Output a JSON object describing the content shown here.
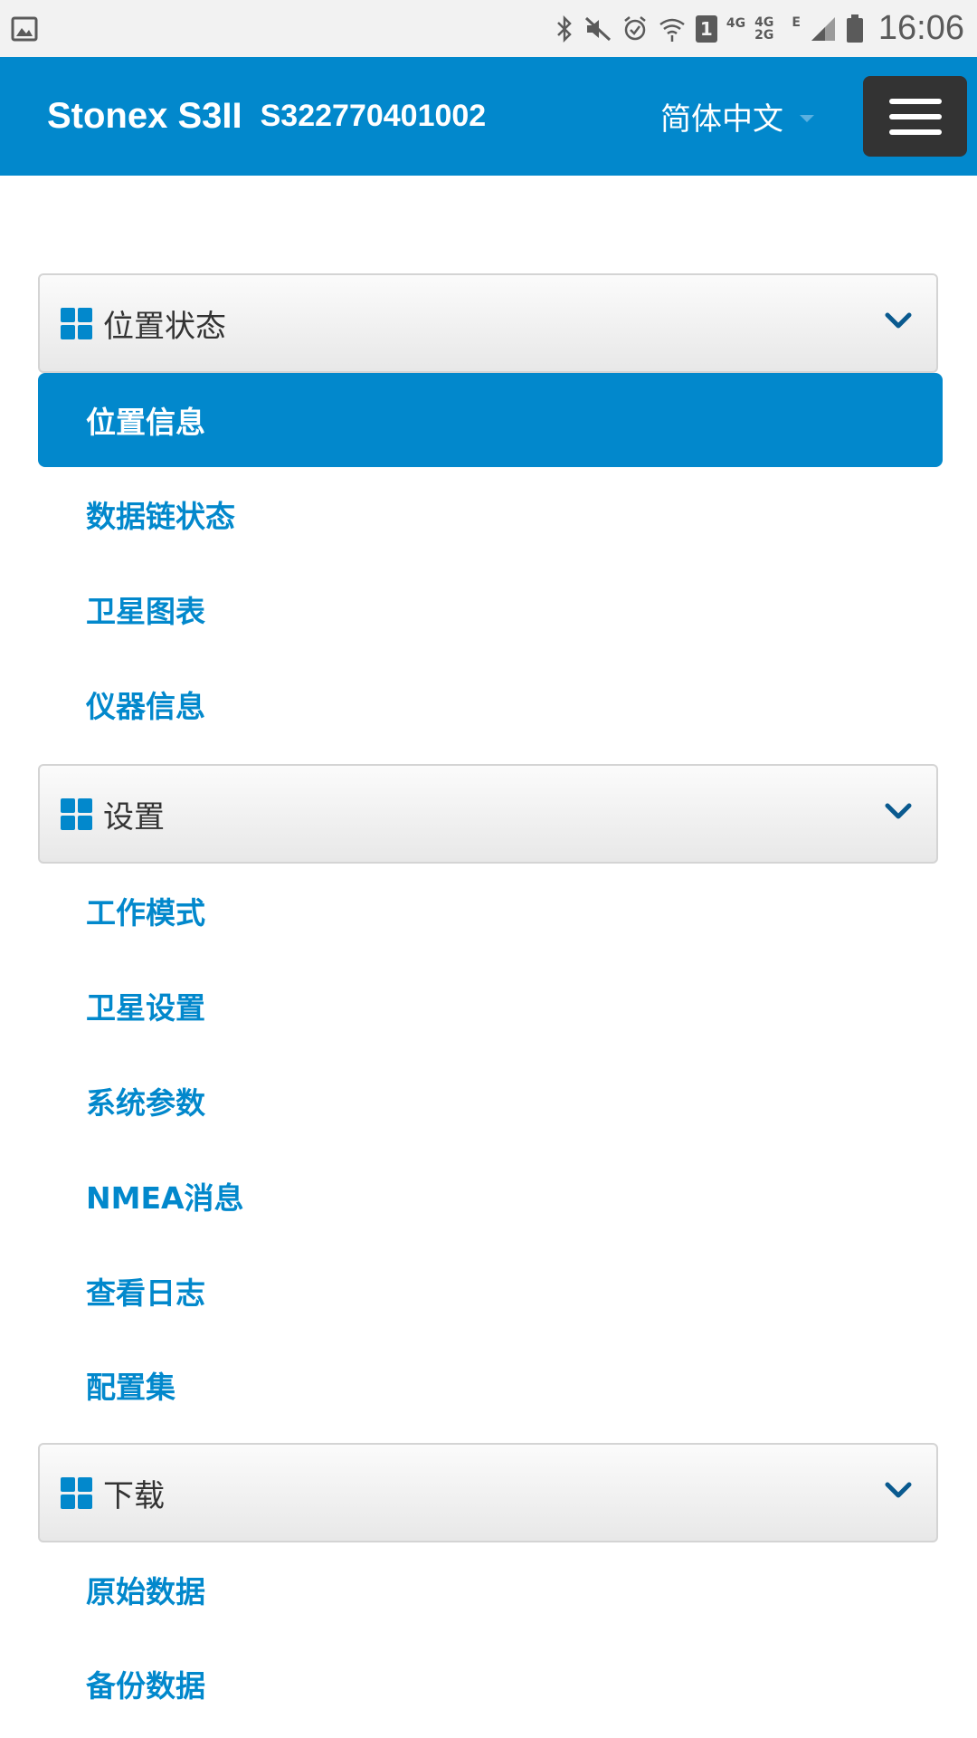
{
  "status_bar": {
    "time": "16:06",
    "sim_badge": "1",
    "net_4g": "4G",
    "net_4g_top": "4G",
    "net_2g_bottom": "2G",
    "net_e": "E",
    "icons": [
      "gallery-icon",
      "bluetooth-icon",
      "mute-icon",
      "alarm-icon",
      "wifi-icon",
      "sim-icon",
      "signal-icon",
      "battery-icon"
    ]
  },
  "header": {
    "brand": "Stonex S3II",
    "serial": "S322770401002",
    "language": "简体中文"
  },
  "colors": {
    "accent": "#0288cc",
    "toggle_bg": "#333333",
    "status_bg": "#f2f2f2"
  },
  "sections": [
    {
      "title": "位置状态",
      "items": [
        "位置信息",
        "数据链状态",
        "卫星图表",
        "仪器信息"
      ],
      "active_item": "位置信息"
    },
    {
      "title": "设置",
      "items": [
        "工作模式",
        "卫星设置",
        "系统参数",
        "NMEA消息",
        "查看日志",
        "配置集"
      ]
    },
    {
      "title": "下载",
      "items": [
        "原始数据",
        "备份数据"
      ]
    }
  ]
}
